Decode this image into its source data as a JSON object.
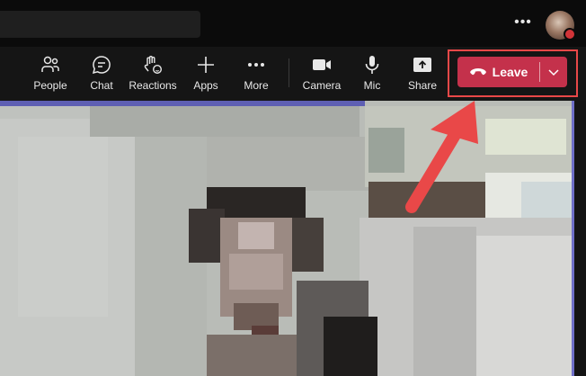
{
  "header": {
    "more_icon": "more-dots-icon",
    "avatar_status_color": "#d13438"
  },
  "toolbar": {
    "items": [
      {
        "label": "People",
        "icon": "people-icon"
      },
      {
        "label": "Chat",
        "icon": "chat-icon"
      },
      {
        "label": "Reactions",
        "icon": "reactions-icon"
      },
      {
        "label": "Apps",
        "icon": "plus-icon"
      },
      {
        "label": "More",
        "icon": "more-dots-icon"
      },
      {
        "label": "Camera",
        "icon": "camera-icon"
      },
      {
        "label": "Mic",
        "icon": "microphone-icon"
      },
      {
        "label": "Share",
        "icon": "share-icon"
      }
    ],
    "leave": {
      "label": "Leave",
      "icon": "phone-hangup-icon",
      "dropdown_icon": "chevron-down-icon",
      "color": "#c4314b"
    }
  },
  "annotation": {
    "highlight_color": "#e94848",
    "arrow_color": "#e94848"
  }
}
